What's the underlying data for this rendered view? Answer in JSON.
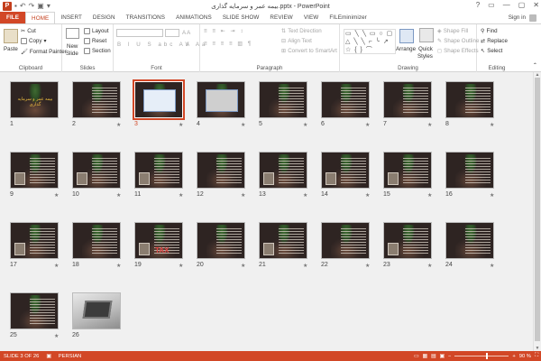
{
  "app": {
    "title": "بیمه عمر و سرمایه گذاری.pptx - PowerPoint",
    "logo": "P",
    "window_buttons": [
      "?",
      "▭",
      "—",
      "▢",
      "✕"
    ],
    "sign_in": "Sign in"
  },
  "tabs": [
    {
      "label": "FILE"
    },
    {
      "label": "HOME"
    },
    {
      "label": "INSERT"
    },
    {
      "label": "DESIGN"
    },
    {
      "label": "TRANSITIONS"
    },
    {
      "label": "ANIMATIONS"
    },
    {
      "label": "SLIDE SHOW"
    },
    {
      "label": "REVIEW"
    },
    {
      "label": "VIEW"
    },
    {
      "label": "FILEminimizer"
    }
  ],
  "ribbon": {
    "clipboard": {
      "label": "Clipboard",
      "paste": "Paste",
      "cut": "Cut",
      "copy": "Copy",
      "format_painter": "Format Painter"
    },
    "slides": {
      "label": "Slides",
      "new_slide": "New",
      "new_slide2": "Slide",
      "layout": "Layout",
      "reset": "Reset",
      "section": "Section"
    },
    "font": {
      "label": "Font"
    },
    "paragraph": {
      "label": "Paragraph",
      "text_direction": "Text Direction",
      "align_text": "Align Text",
      "convert_smartart": "Convert to SmartArt"
    },
    "drawing": {
      "label": "Drawing",
      "shapes_glyphs": "▭ ╲ ╲ ▭ ○ ▢ △ ╲ ╲ ⌐ ╰ ↗ ☆ { } ⌒",
      "arrange": "Arrange",
      "quick": "Quick",
      "styles": "Styles",
      "shape_fill": "Shape Fill",
      "shape_outline": "Shape Outline",
      "shape_effects": "Shape Effects"
    },
    "editing": {
      "label": "Editing",
      "find": "Find",
      "replace": "Replace",
      "select": "Select"
    }
  },
  "slides": [
    {
      "num": "1",
      "star": ""
    },
    {
      "num": "2",
      "star": "★"
    },
    {
      "num": "3",
      "star": "★"
    },
    {
      "num": "4",
      "star": "★"
    },
    {
      "num": "5",
      "star": "★"
    },
    {
      "num": "6",
      "star": "★"
    },
    {
      "num": "7",
      "star": "★"
    },
    {
      "num": "8",
      "star": "★"
    },
    {
      "num": "9",
      "star": "★"
    },
    {
      "num": "10",
      "star": "★"
    },
    {
      "num": "11",
      "star": "★"
    },
    {
      "num": "12",
      "star": "★"
    },
    {
      "num": "13",
      "star": "★"
    },
    {
      "num": "14",
      "star": "★"
    },
    {
      "num": "15",
      "star": "★"
    },
    {
      "num": "16",
      "star": "★"
    },
    {
      "num": "17",
      "star": "★"
    },
    {
      "num": "18",
      "star": "★"
    },
    {
      "num": "19",
      "star": "★"
    },
    {
      "num": "20",
      "star": "★"
    },
    {
      "num": "21",
      "star": "★"
    },
    {
      "num": "22",
      "star": "★"
    },
    {
      "num": "23",
      "star": "★"
    },
    {
      "num": "24",
      "star": "★"
    },
    {
      "num": "25",
      "star": "★"
    },
    {
      "num": "26",
      "star": ""
    }
  ],
  "selected_slide": "3",
  "slide1_title": "بیمه عمر و سرمایه گذاری",
  "slide19_text": "TAX",
  "status": {
    "slide_info": "SLIDE 3 OF 26",
    "language": "PERSIAN",
    "zoom": "90 %",
    "zoom_fraction": 0.6
  },
  "colors": {
    "accent": "#d24726",
    "slide_bg": "#2e2422"
  }
}
